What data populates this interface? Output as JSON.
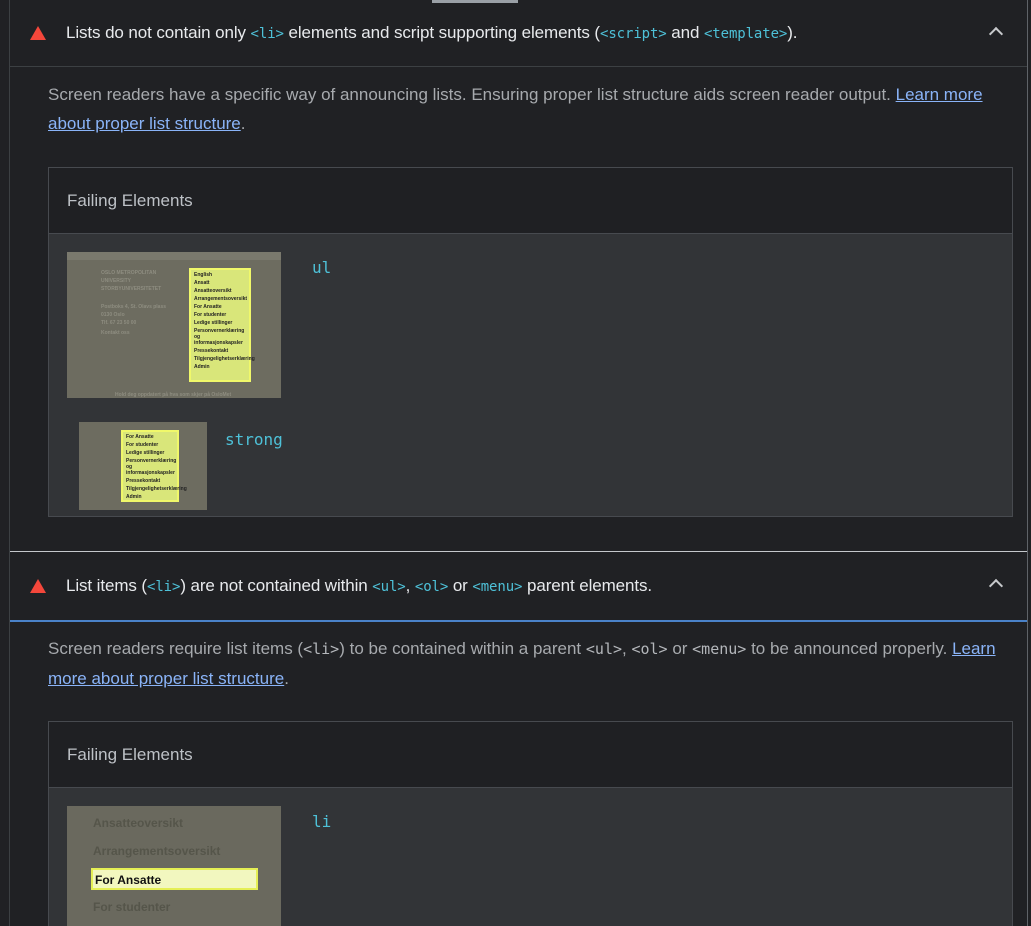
{
  "audit1": {
    "title_parts": {
      "a": "Lists do not contain only ",
      "code1": "<li>",
      "b": " elements and script supporting elements (",
      "code2": "<script>",
      "c": " and ",
      "code3": "<template>",
      "d": ")."
    },
    "description": "Screen readers have a specific way of announcing lists. Ensuring proper list structure aids screen reader output. ",
    "link": "Learn more about proper list structure",
    "after_link": ".",
    "table_header": "Failing Elements",
    "nodes": [
      {
        "label": "ul"
      },
      {
        "label": "strong"
      }
    ],
    "thumb1_items": [
      "English",
      "Ansatt",
      "Ansatteoversikt",
      "Arrangementsoversikt",
      "For Ansatte",
      "For studenter",
      "Ledige stillinger",
      "Personvernerklæring og informasjonskapsler",
      "Pressekontakt",
      "Tilgjengelighetserklæring",
      "Admin"
    ],
    "thumb1_text": [
      "OSLO METROPOLITAN",
      "UNIVERSITY",
      "STORBYUNIVERSITETET",
      "Postboks 4, St. Olavs plass",
      "0130 Oslo",
      "Tlf. 67 23 50 00",
      "Kontakt oss",
      "Hold deg oppdatert på hva som skjer på OsloMet"
    ],
    "thumb2_items": [
      "For Ansatte",
      "For studenter",
      "Ledige stillinger",
      "Personvernerklæring og informasjonskapsler",
      "Pressekontakt",
      "Tilgjengelighetserklæring",
      "Admin"
    ]
  },
  "audit2": {
    "title_parts": {
      "a": "List items (",
      "code1": "<li>",
      "b": ") are not contained within ",
      "code2": "<ul>",
      "c": ", ",
      "code3": "<ol>",
      "d": " or ",
      "code4": "<menu>",
      "e": " parent elements."
    },
    "description_parts": {
      "a": "Screen readers require list items (",
      "m1": "<li>",
      "b": ") to be contained within a parent ",
      "m2": "<ul>",
      "c": ", ",
      "m3": "<ol>",
      "d": " or ",
      "m4": "<menu>",
      "e": " to be announced properly. "
    },
    "link": "Learn more about proper list structure",
    "after_link": ".",
    "table_header": "Failing Elements",
    "nodes": [
      {
        "label": "li"
      }
    ],
    "thumb3_items": [
      "Ansatteoversikt",
      "Arrangementsoversikt",
      "For Ansatte",
      "For studenter"
    ]
  }
}
